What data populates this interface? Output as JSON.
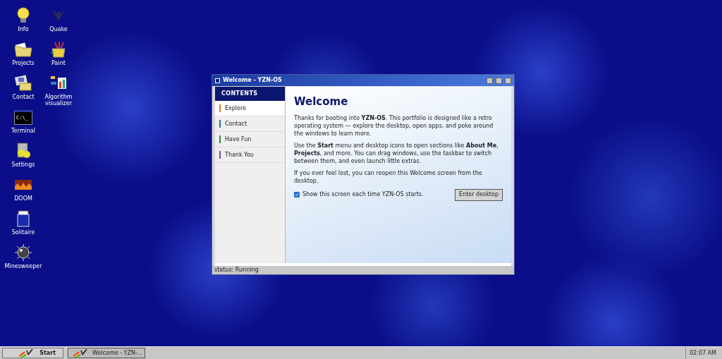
{
  "desktop_icons": [
    {
      "label": "Info",
      "kind": "bulb"
    },
    {
      "label": "Projects",
      "kind": "folder"
    },
    {
      "label": "Contact",
      "kind": "contact"
    },
    {
      "label": "Terminal",
      "kind": "terminal",
      "glyph": "C:\\_"
    },
    {
      "label": "Settings",
      "kind": "settings"
    },
    {
      "label": "DOOM",
      "kind": "doom"
    },
    {
      "label": "Solitaire",
      "kind": "cards"
    },
    {
      "label": "Minesweeper",
      "kind": "mine"
    },
    {
      "label": "Quake",
      "kind": "bird"
    },
    {
      "label": "Paint",
      "kind": "paint"
    },
    {
      "label": "Algorithm visualizer",
      "kind": "chart"
    }
  ],
  "window": {
    "title": "Welcome - YZN-OS",
    "sidebar": {
      "header": "CONTENTS",
      "items": [
        {
          "label": "Explore",
          "color": "#e07a2a",
          "selected": true
        },
        {
          "label": "Contact",
          "color": "#2a6a9a",
          "selected": false
        },
        {
          "label": "Have Fun",
          "color": "#2a8a3a",
          "selected": false
        },
        {
          "label": "Thank You",
          "color": "#6a5a9a",
          "selected": false
        }
      ]
    },
    "heading": "Welcome",
    "paragraphs": [
      "Thanks for booting into **YZN-OS**. This portfolio is designed like a retro operating system — explore the desktop, open apps, and poke around the windows to learn more.",
      "Use the **Start** menu and desktop icons to open sections like **About Me**, **Projects**, and more. You can drag windows, use the taskbar to switch between them, and even launch little extras.",
      "If you ever feel lost, you can reopen this Welcome screen from the desktop."
    ],
    "checkbox": {
      "label": "Show this screen each time YZN-OS starts.",
      "checked": true
    },
    "button": "Enter desktop",
    "status": "status: Running"
  },
  "taskbar": {
    "start": "Start",
    "tasks": [
      {
        "label": "Welcome - YZN-...",
        "selected": true
      }
    ],
    "clock": "02:07 AM"
  }
}
